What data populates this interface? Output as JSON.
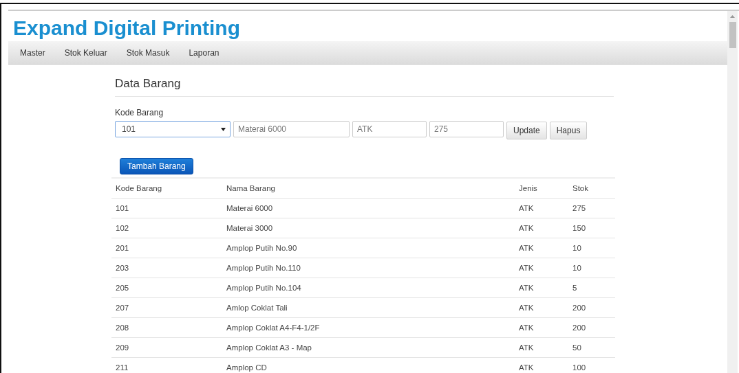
{
  "brand": "Expand Digital Printing",
  "nav": [
    {
      "label": "Master"
    },
    {
      "label": "Stok Keluar"
    },
    {
      "label": "Stok Masuk"
    },
    {
      "label": "Laporan"
    }
  ],
  "page_title": "Data Barang",
  "form": {
    "label": "Kode Barang",
    "select_value": "101",
    "nama": "Materai 6000",
    "jenis": "ATK",
    "stok": "275",
    "buttons": [
      "Update",
      "Hapus"
    ]
  },
  "add_button": "Tambah Barang",
  "table": {
    "columns": [
      "Kode Barang",
      "Nama Barang",
      "Jenis",
      "Stok"
    ],
    "rows": [
      [
        "101",
        "Materai 6000",
        "ATK",
        "275"
      ],
      [
        "102",
        "Materai 3000",
        "ATK",
        "150"
      ],
      [
        "201",
        "Amplop Putih No.90",
        "ATK",
        "10"
      ],
      [
        "203",
        "Amplop Putih No.110",
        "ATK",
        "10"
      ],
      [
        "205",
        "Amplop Putih No.104",
        "ATK",
        "5"
      ],
      [
        "207",
        "Amlop Coklat Tali",
        "ATK",
        "200"
      ],
      [
        "208",
        "Amplop Coklat A4-F4-1/2F",
        "ATK",
        "200"
      ],
      [
        "209",
        "Amplop Coklat A3 - Map",
        "ATK",
        "50"
      ],
      [
        "211",
        "Amplop CD",
        "ATK",
        "100"
      ]
    ]
  }
}
